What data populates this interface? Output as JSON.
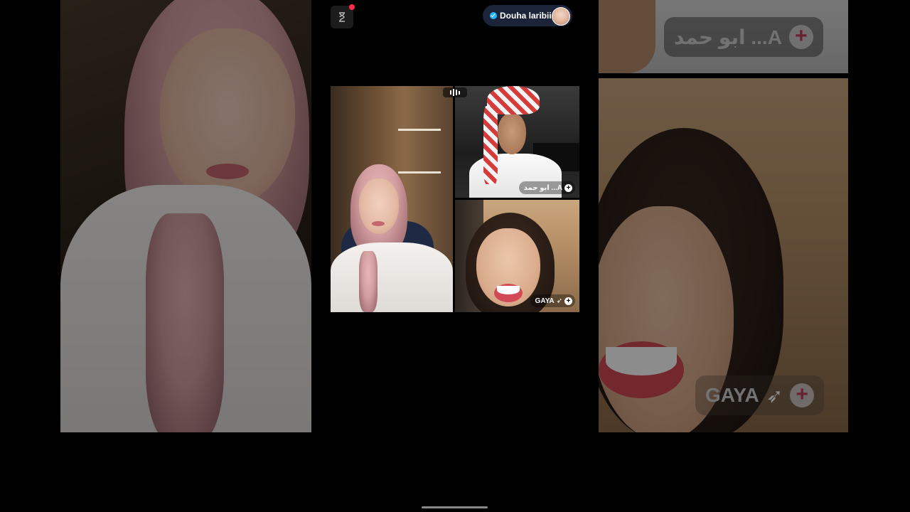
{
  "session": {
    "host_name": "Douha laribii",
    "host_verified": true,
    "notification": true
  },
  "grid": {
    "participants": [
      {
        "position": "left",
        "name": ""
      },
      {
        "position": "top-right",
        "name": "ابو حمد ...A"
      },
      {
        "position": "bottom-right",
        "name": "GAYA"
      }
    ],
    "audio_indicator": "speaking"
  },
  "side_panels": {
    "right_top_label": "ابو حمد ...A",
    "right_bottom_label": "GAYA"
  },
  "icons": {
    "top_left": "hourglass-icon",
    "verified": "verified-badge-icon",
    "add": "plus-icon",
    "bird": "bird-icon"
  },
  "colors": {
    "notification_dot": "#ff2d4a",
    "verified": "#27b4ff",
    "host_pill": "#1b2438",
    "plus_accent": "#c23b5a"
  }
}
